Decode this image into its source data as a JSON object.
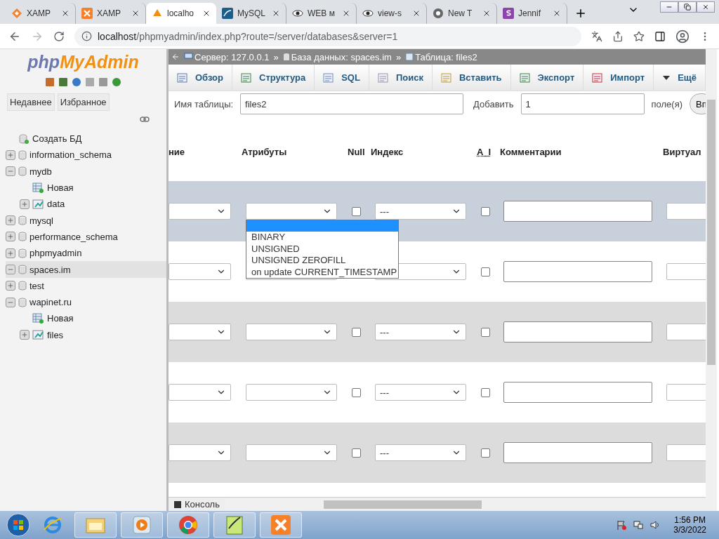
{
  "browser": {
    "tabs": [
      {
        "label": "XAMP",
        "kind": "xampp-diamond",
        "selected": false
      },
      {
        "label": "XAMP",
        "kind": "xampp",
        "selected": false
      },
      {
        "label": "localho",
        "kind": "pma",
        "selected": true
      },
      {
        "label": "MySQL",
        "kind": "mysql",
        "selected": false
      },
      {
        "label": "WEB м",
        "kind": "eye",
        "selected": false
      },
      {
        "label": "view-s",
        "kind": "eye",
        "selected": false
      },
      {
        "label": "New T",
        "kind": "chrome",
        "selected": false
      },
      {
        "label": "Jennif",
        "kind": "s",
        "selected": false
      }
    ],
    "url_host": "localhost",
    "url_path": "/phpmyadmin/index.php?route=/server/databases&server=1"
  },
  "sidebar": {
    "logo_left": "php",
    "logo_right": "MyAdmin",
    "buttons": [
      "Недавнее",
      "Избранное"
    ],
    "tree": [
      {
        "label": "Создать БД",
        "kind": "new-db",
        "selected": false
      },
      {
        "label": "information_schema",
        "kind": "db",
        "expanded": false,
        "selected": false
      },
      {
        "label": "mydb",
        "kind": "db",
        "expanded": true,
        "selected": false,
        "children": [
          {
            "label": "Новая",
            "kind": "new-table",
            "selected": false
          },
          {
            "label": "data",
            "kind": "table",
            "expanded": false,
            "selected": false
          }
        ]
      },
      {
        "label": "mysql",
        "kind": "db",
        "expanded": false,
        "selected": false
      },
      {
        "label": "performance_schema",
        "kind": "db",
        "expanded": false,
        "selected": false
      },
      {
        "label": "phpmyadmin",
        "kind": "db",
        "expanded": false,
        "selected": false
      },
      {
        "label": "spaces.im",
        "kind": "db",
        "expanded": true,
        "selected": true
      },
      {
        "label": "test",
        "kind": "db",
        "expanded": false,
        "selected": false
      },
      {
        "label": "wapinet.ru",
        "kind": "db",
        "expanded": true,
        "selected": false,
        "children": [
          {
            "label": "Новая",
            "kind": "new-table",
            "selected": false
          },
          {
            "label": "files",
            "kind": "table",
            "expanded": false,
            "selected": false
          }
        ]
      }
    ]
  },
  "breadcrumbs": [
    {
      "label": "Сервер: 127.0.0.1",
      "kind": "server"
    },
    {
      "separator": "»",
      "label": "База данных: spaces.im",
      "kind": "db"
    },
    {
      "separator": "»",
      "label": "Таблица: files2",
      "kind": "table"
    }
  ],
  "menu": [
    {
      "label": "Обзор",
      "kind": "browse"
    },
    {
      "label": "Структура",
      "kind": "structure"
    },
    {
      "label": "SQL",
      "kind": "sql"
    },
    {
      "label": "Поиск",
      "kind": "search"
    },
    {
      "label": "Вставить",
      "kind": "insert"
    },
    {
      "label": "Экспорт",
      "kind": "export"
    },
    {
      "label": "Импорт",
      "kind": "import"
    },
    {
      "label": "Ещё",
      "kind": "more"
    }
  ],
  "form": {
    "name_label": "Имя таблицы:",
    "name_value": "files2",
    "add_label": "Добавить",
    "add_value": "1",
    "unit": "поле(я)",
    "button": "Вп"
  },
  "columns": [
    "ние",
    "Атрибуты",
    "Null",
    "Индекс",
    "A_I",
    "Комментарии",
    "Виртуал"
  ],
  "rows": [
    {
      "highlighted": true,
      "index": "---",
      "null_checked": false,
      "ai_checked": false
    },
    {
      "highlighted": false,
      "ai_checked": false
    },
    {
      "highlighted": false,
      "index": "---",
      "null_checked": false,
      "ai_checked": false
    },
    {
      "highlighted": false,
      "index": "---",
      "null_checked": false,
      "ai_checked": false
    },
    {
      "highlighted": false,
      "index": "---",
      "null_checked": false,
      "ai_checked": false
    }
  ],
  "dropdown": {
    "open": true,
    "blank_option_highlighted": true,
    "options": [
      "BINARY",
      "UNSIGNED",
      "UNSIGNED ZEROFILL",
      "on update CURRENT_TIMESTAMP"
    ]
  },
  "console": "Консоль",
  "taskbar": {
    "apps": [
      {
        "kind": "ie"
      },
      {
        "kind": "explorer"
      },
      {
        "kind": "media"
      },
      {
        "kind": "chrome"
      },
      {
        "kind": "notepad"
      },
      {
        "kind": "xampp"
      }
    ],
    "time": "1:56 PM",
    "date": "3/3/2022"
  }
}
